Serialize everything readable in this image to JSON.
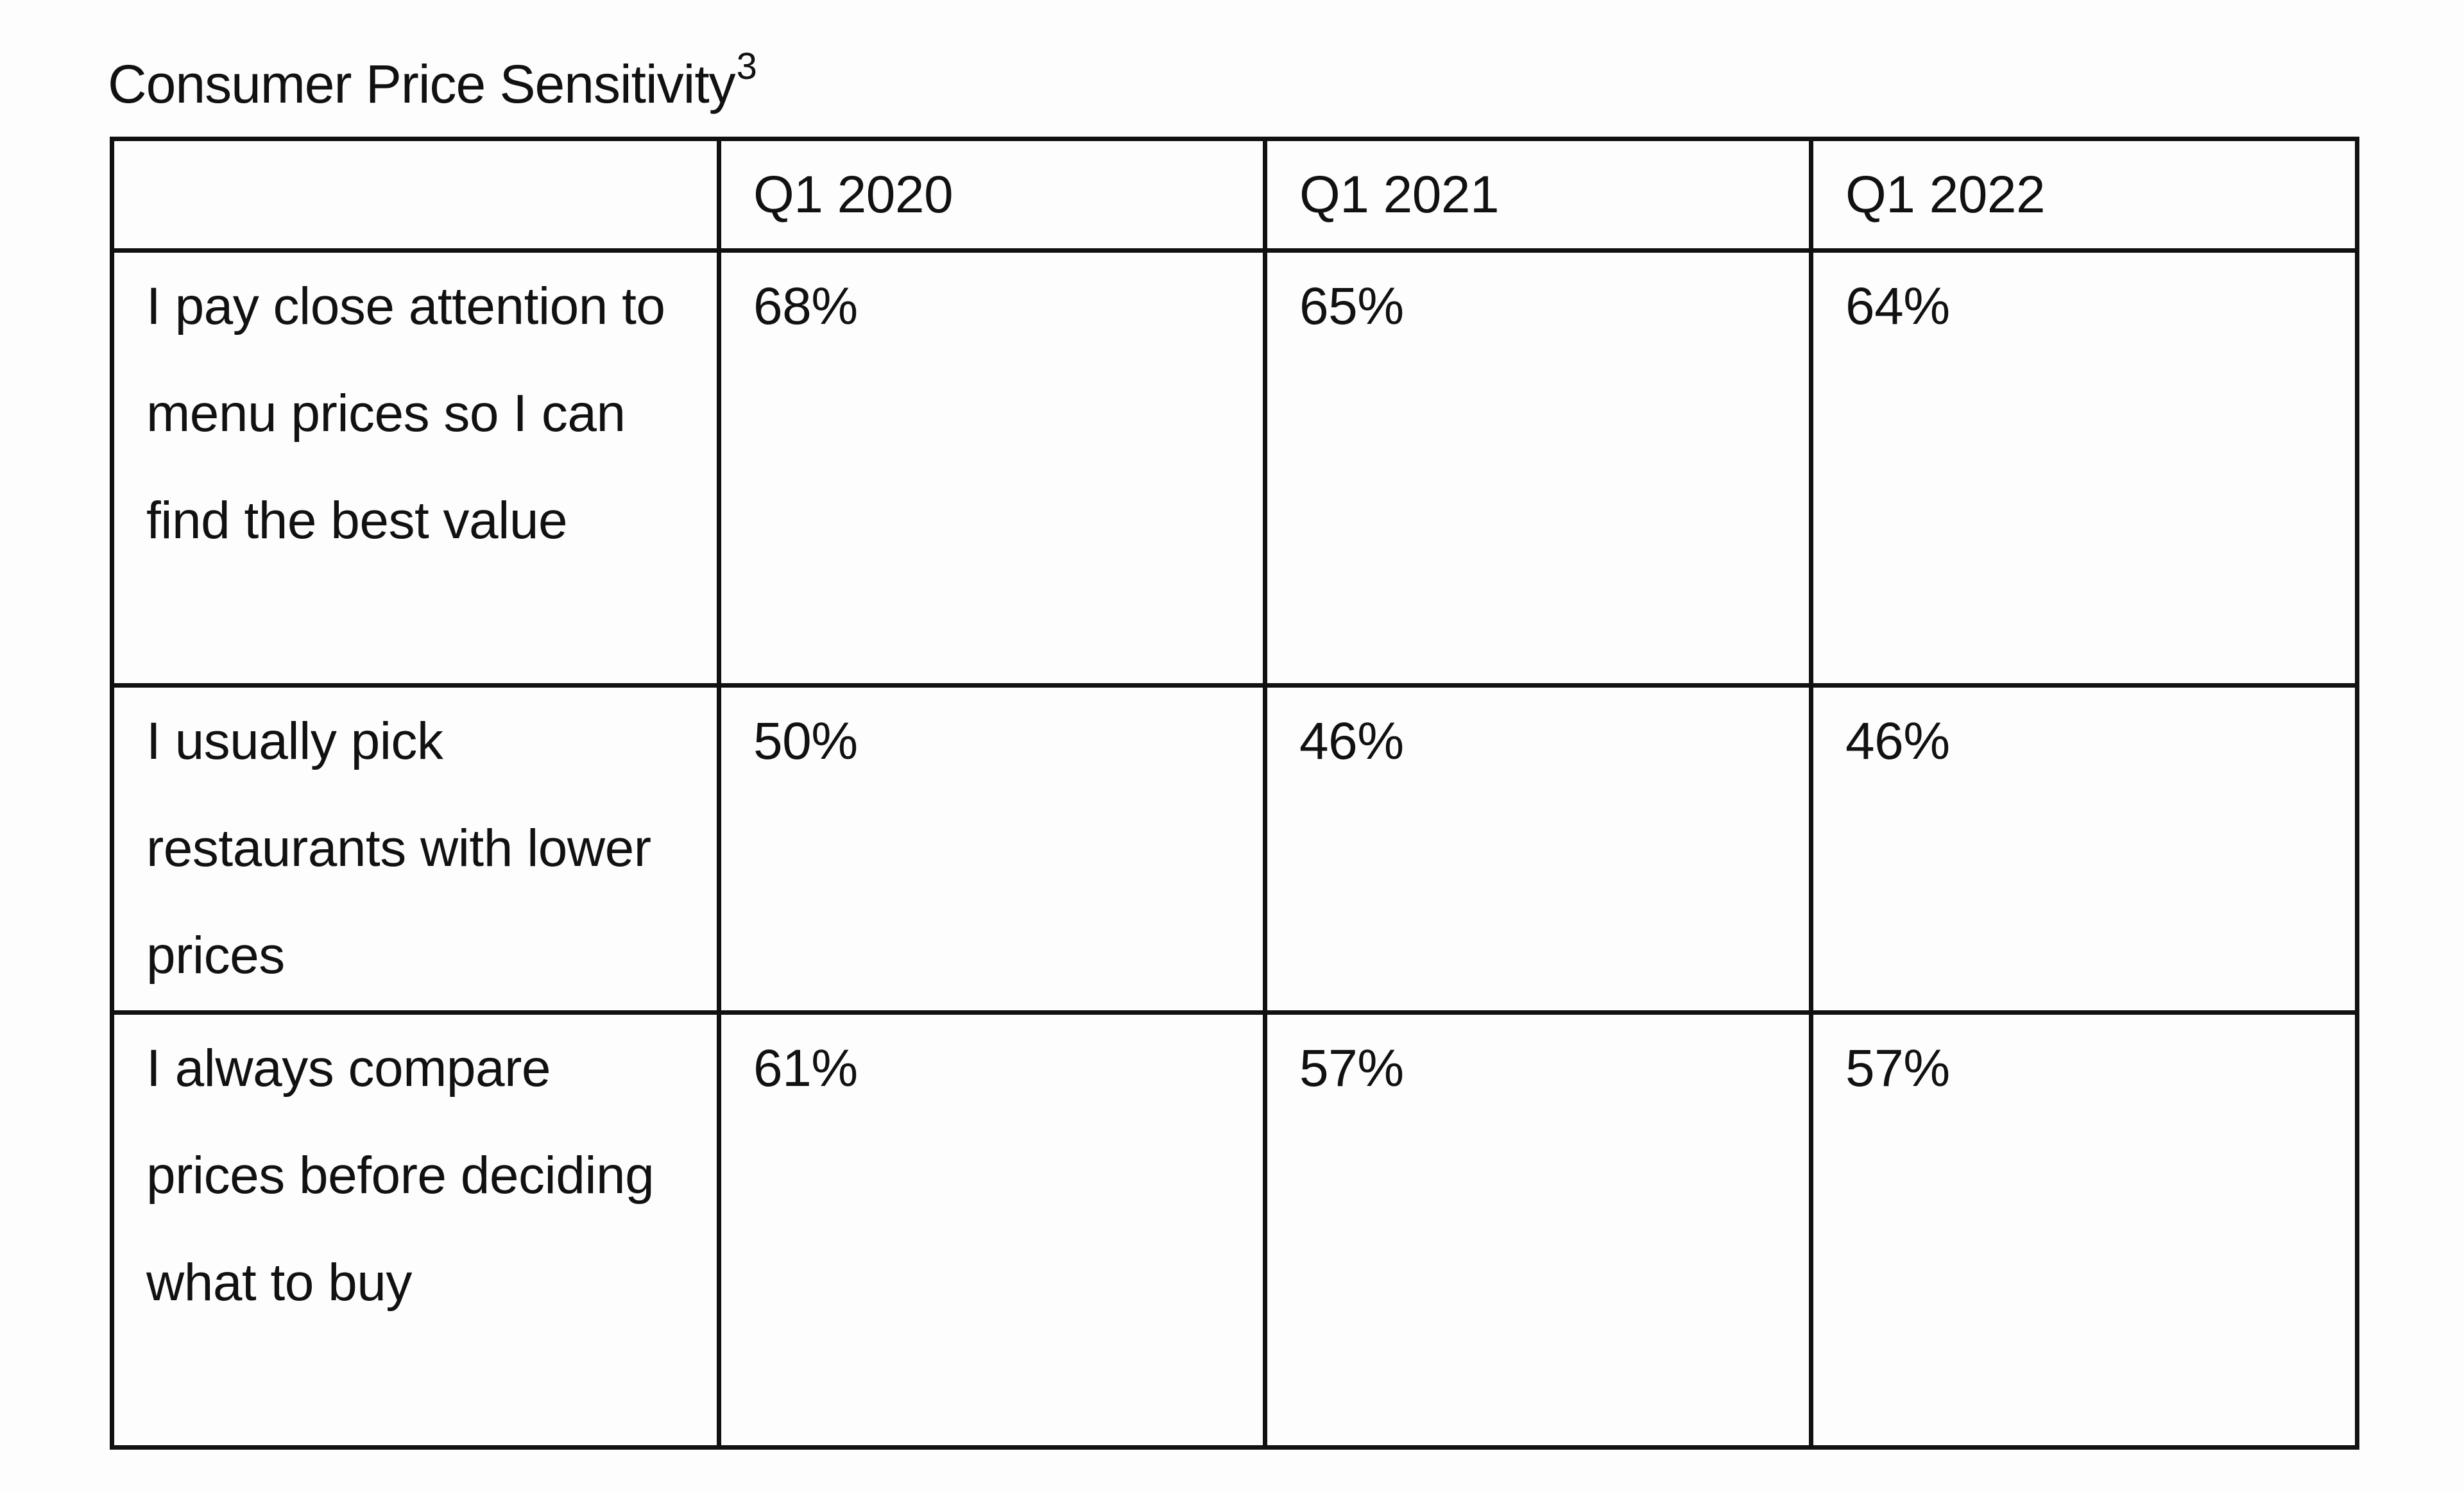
{
  "document": {
    "title": "Consumer Price Sensitivity",
    "title_superscript": "3"
  },
  "table": {
    "corner_header": "",
    "columns": [
      "Q1 2020",
      "Q1 2021",
      "Q1 2022"
    ],
    "rows": [
      {
        "label": "I pay close attention to menu prices so I can find the best value",
        "values": [
          "68%",
          "65%",
          "64%"
        ]
      },
      {
        "label": "I usually pick restaurants with lower prices",
        "values": [
          "50%",
          "46%",
          "46%"
        ]
      },
      {
        "label": "I always compare prices before deciding what to buy",
        "values": [
          "61%",
          "57%",
          "57%"
        ]
      }
    ]
  }
}
